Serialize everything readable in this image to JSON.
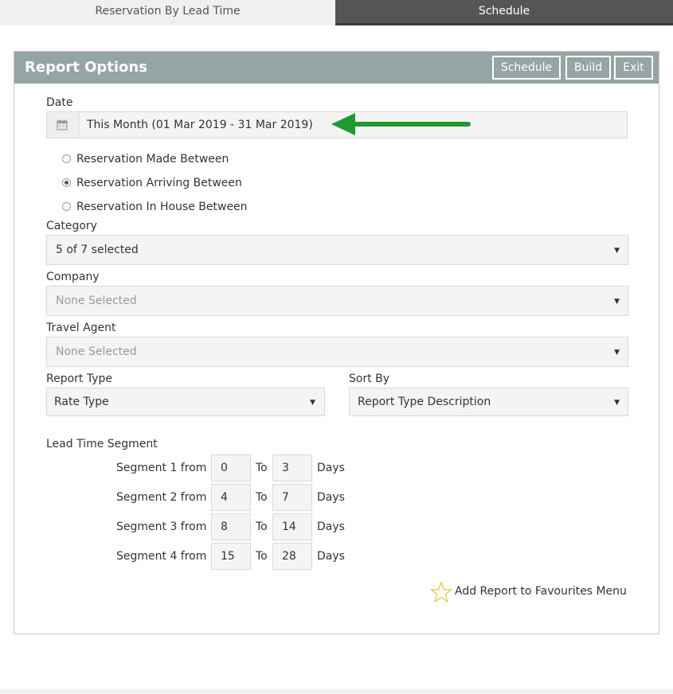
{
  "tabs": {
    "lead_time": "Reservation By Lead Time",
    "schedule": "Schedule"
  },
  "panel": {
    "title": "Report Options",
    "buttons": {
      "schedule": "Schedule",
      "build": "Build",
      "exit": "Exit"
    }
  },
  "date": {
    "label": "Date",
    "value": "This Month (01 Mar 2019 - 31 Mar 2019)",
    "icon": "calendar-icon"
  },
  "radios": [
    {
      "label": "Reservation Made Between",
      "checked": false
    },
    {
      "label": "Reservation Arriving Between",
      "checked": true
    },
    {
      "label": "Reservation In House Between",
      "checked": false
    }
  ],
  "category": {
    "label": "Category",
    "value": "5 of 7 selected"
  },
  "company": {
    "label": "Company",
    "placeholder": "None Selected"
  },
  "travel_agent": {
    "label": "Travel Agent",
    "placeholder": "None Selected"
  },
  "report_type": {
    "label": "Report Type",
    "value": "Rate Type"
  },
  "sort_by": {
    "label": "Sort By",
    "value": "Report Type Description"
  },
  "lead_time": {
    "label": "Lead Time Segment",
    "to_label": "To",
    "days_label": "Days",
    "segments": [
      {
        "label": "Segment 1 from",
        "from": "0",
        "to": "3"
      },
      {
        "label": "Segment 2 from",
        "from": "4",
        "to": "7"
      },
      {
        "label": "Segment 3 from",
        "from": "8",
        "to": "14"
      },
      {
        "label": "Segment 4 from",
        "from": "15",
        "to": "28"
      }
    ]
  },
  "favourites": {
    "label": "Add Report to Favourites Menu",
    "icon": "star-icon"
  },
  "colors": {
    "header_bg": "#95a5a3",
    "arrow": "#1e9b2f",
    "star": "#e8c53a",
    "active_tab": "#555555"
  }
}
